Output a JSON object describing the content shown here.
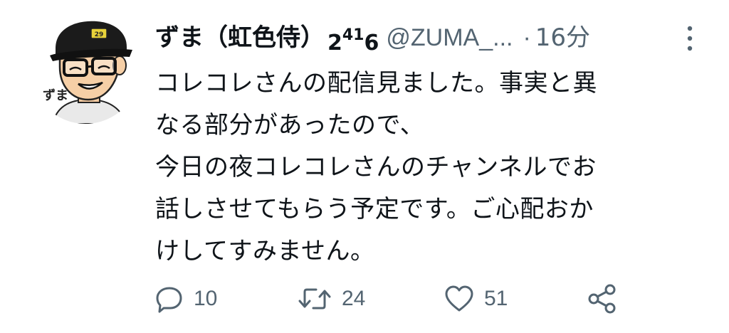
{
  "tweet": {
    "author": {
      "display_name": "ずま（虹色侍）",
      "name_suffix_sub1": "2",
      "name_suffix_sup": "41",
      "name_suffix_sub2": "6",
      "handle": "@ZUMA_...",
      "avatar_caption": "ずま"
    },
    "separator": "·",
    "timestamp": "16分",
    "text_lines": [
      "コレコレさんの配信見ました。事実と異",
      "なる部分があったので、",
      "今日の夜コレコレさんのチャンネルでお",
      "話しさせてもらう予定です。ご心配おか",
      "けしてすみません。"
    ],
    "actions": {
      "reply_count": "10",
      "retweet_count": "24",
      "like_count": "51"
    }
  },
  "colors": {
    "text_primary": "#0f1419",
    "text_secondary": "#536471"
  },
  "icons": {
    "more": "more-vertical-icon",
    "reply": "reply-icon",
    "retweet": "retweet-icon",
    "like": "heart-icon",
    "share": "share-icon"
  }
}
